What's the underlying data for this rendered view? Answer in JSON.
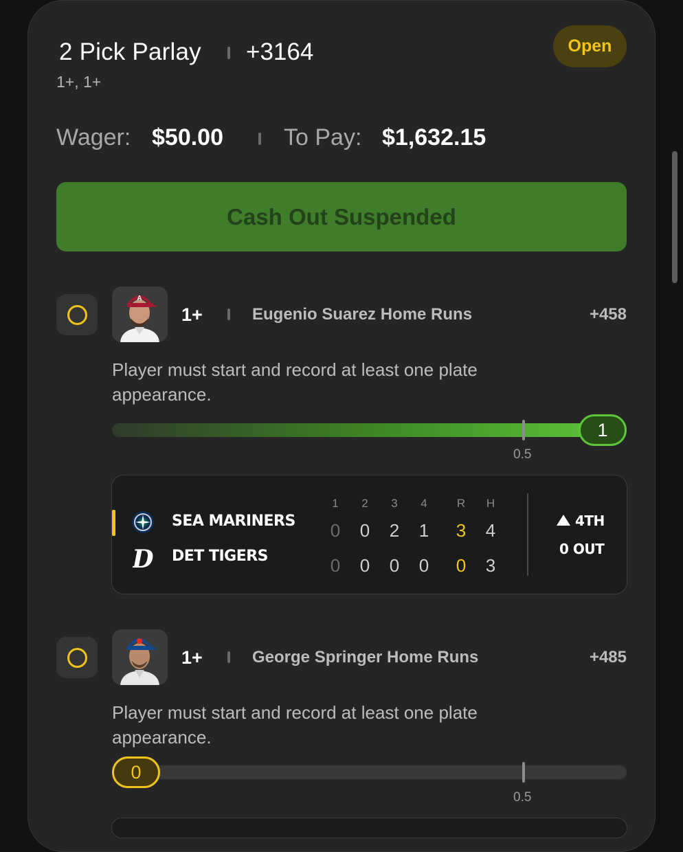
{
  "bet": {
    "title": "2 Pick Parlay",
    "odds": "+3164",
    "subtitle": "1+, 1+",
    "status": "Open",
    "wager_label": "Wager:",
    "wager_value": "$50.00",
    "pay_label": "To Pay:",
    "pay_value": "$1,632.15",
    "cashout_label": "Cash Out Suspended"
  },
  "legs": [
    {
      "line": "1+",
      "market": "Eugenio Suarez Home Runs",
      "odds": "+458",
      "rule": "Player must start and record at least one plate appearance.",
      "current": "1",
      "threshold": "0.5",
      "progress": 1.0,
      "team_color": "#a71930",
      "status_color": "#5cc53a",
      "avatar_icon": "player-photo-icon"
    },
    {
      "line": "1+",
      "market": "George Springer Home Runs",
      "odds": "+485",
      "rule": "Player must start and record at least one plate appearance.",
      "current": "0",
      "threshold": "0.5",
      "progress": 0.0,
      "team_color": "#134a8e",
      "status_color": "#f0c419",
      "avatar_icon": "player-photo-icon"
    }
  ],
  "scoreboard": {
    "columns": [
      "1",
      "2",
      "3",
      "4",
      "R",
      "H"
    ],
    "teams": [
      {
        "name": "SEA MARINERS",
        "logo_icon": "mariners-logo-icon",
        "scores": [
          "0",
          "0",
          "2",
          "1",
          "3",
          "4"
        ]
      },
      {
        "name": "DET TIGERS",
        "logo_icon": "tigers-logo-icon",
        "scores": [
          "0",
          "0",
          "0",
          "0",
          "0",
          "3"
        ]
      }
    ],
    "inning": "4TH",
    "outs": "0 OUT"
  },
  "colors": {
    "accent_yellow": "#f0c419",
    "accent_green": "#5cc53a",
    "cashout_bg": "#3f7d2a"
  }
}
